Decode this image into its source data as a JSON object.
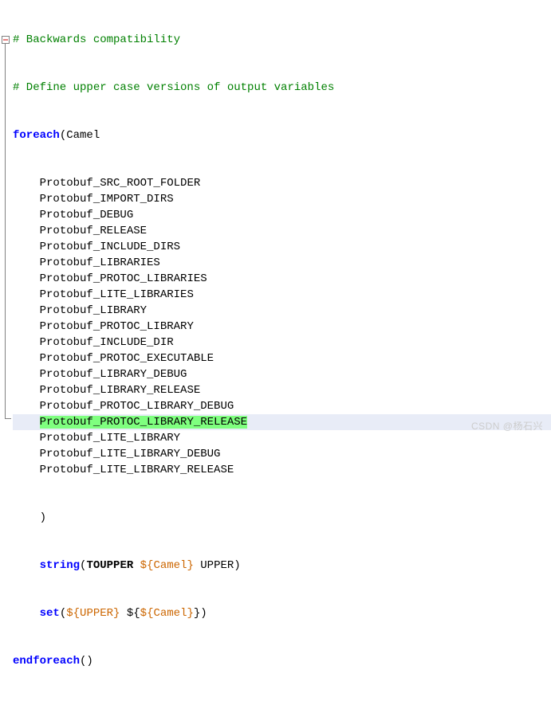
{
  "code": {
    "comment1": "# Backwards compatibility",
    "comment2": "# Define upper case versions of output variables",
    "foreach_kw": "foreach",
    "foreach_open": "(Camel",
    "items": [
      "Protobuf_SRC_ROOT_FOLDER",
      "Protobuf_IMPORT_DIRS",
      "Protobuf_DEBUG",
      "Protobuf_RELEASE",
      "Protobuf_INCLUDE_DIRS",
      "Protobuf_LIBRARIES",
      "Protobuf_PROTOC_LIBRARIES",
      "Protobuf_LITE_LIBRARIES",
      "Protobuf_LIBRARY",
      "Protobuf_PROTOC_LIBRARY",
      "Protobuf_INCLUDE_DIR",
      "Protobuf_PROTOC_EXECUTABLE",
      "Protobuf_LIBRARY_DEBUG",
      "Protobuf_LIBRARY_RELEASE",
      "Protobuf_PROTOC_LIBRARY_DEBUG",
      "Protobuf_PROTOC_LIBRARY_RELEASE",
      "Protobuf_LITE_LIBRARY",
      "Protobuf_LITE_LIBRARY_DEBUG",
      "Protobuf_LITE_LIBRARY_RELEASE"
    ],
    "close_paren": ")",
    "string_kw": "string",
    "string_func": "TOUPPER",
    "string_var": "${Camel}",
    "string_tail": " UPPER)",
    "set_kw": "set",
    "set_open": "(",
    "set_var1": "${UPPER}",
    "set_mid": " ${",
    "set_var2": "${Camel}",
    "set_tail": "})",
    "endforeach_kw": "endforeach",
    "endforeach_tail": "()",
    "highlighted_index": 15,
    "indent_item": "    ",
    "indent_stmt": "    "
  },
  "watermark": "CSDN @杨石兴",
  "colors": {
    "comment": "#008000",
    "keyword": "#0000ff",
    "variable": "#cc6600",
    "selection": "#7fff7f",
    "highlight_line": "#e8ecf7"
  }
}
